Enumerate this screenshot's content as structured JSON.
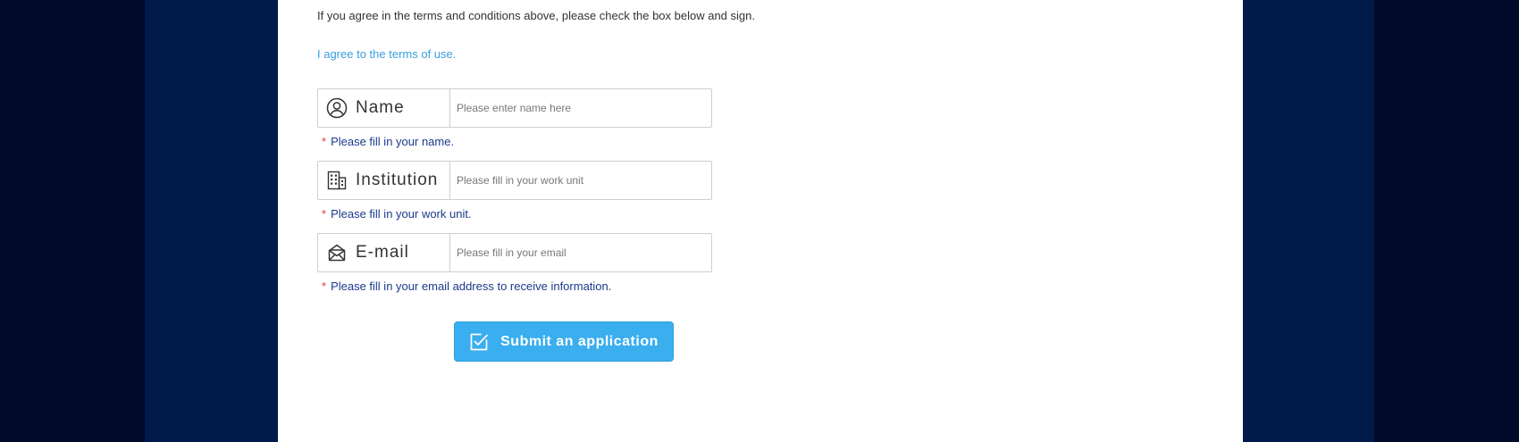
{
  "terms": {
    "intro": "If you agree in the terms and conditions above, please check the box below and sign.",
    "agree_link": "I agree to the terms of use."
  },
  "form": {
    "name": {
      "label": "Name",
      "icon": "user-circle-icon",
      "placeholder": "Please enter name here",
      "value": "",
      "hint": "Please fill in your name."
    },
    "institution": {
      "label": "Institution",
      "icon": "building-icon",
      "placeholder": "Please fill in your work unit",
      "value": "",
      "hint": "Please fill in your work unit."
    },
    "email": {
      "label": "E-mail",
      "icon": "envelope-icon",
      "placeholder": "Please fill in your email",
      "value": "",
      "hint": "Please fill in your email address to receive information."
    },
    "required_marker": "*"
  },
  "submit": {
    "label": "Submit an application",
    "icon": "checkbox-edit-icon"
  },
  "colors": {
    "accent": "#3aaeee",
    "link": "#3aa0e0",
    "hint_text": "#1a3a8a",
    "required_star": "#e53935",
    "background_outer": "#010a28",
    "background_inner": "#001a4a",
    "panel": "#ffffff"
  }
}
